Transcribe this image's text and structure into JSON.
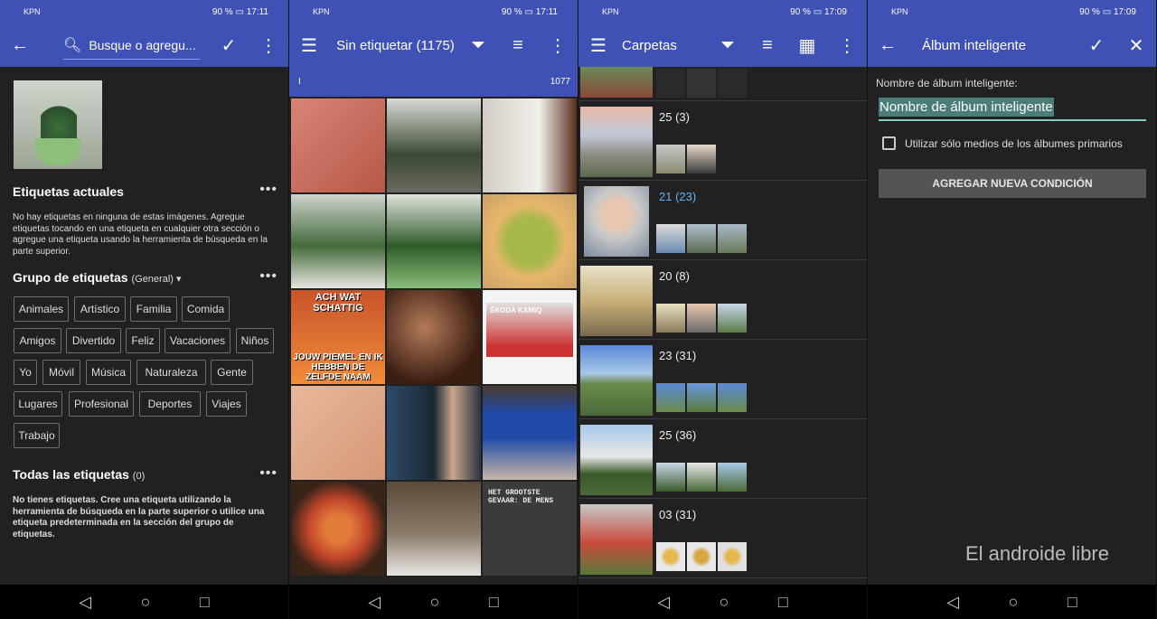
{
  "screen1": {
    "status": {
      "carrier": "KPN",
      "battery": "90 %",
      "time": "17:11"
    },
    "search_placeholder": "Busque o agregu...",
    "current_tags": {
      "title": "Etiquetas actuales",
      "text": "No hay etiquetas en ninguna de estas imágenes. Agregue etiquetas tocando en una etiqueta en cualquier otra sección o agregue una etiqueta usando la herramienta de búsqueda en la parte superior."
    },
    "tag_group": {
      "title": "Grupo de etiquetas",
      "selected": "(General)"
    },
    "chips": [
      "Animales",
      "Artístico",
      "Familia",
      "Comida",
      "Amigos",
      "Divertido",
      "Feliz",
      "Vacaciones",
      "Niños",
      "Yo",
      "Móvil",
      "Música",
      "Naturaleza",
      "Gente",
      "Lugares",
      "Profesional",
      "Deportes",
      "Viajes",
      "Trabajo"
    ],
    "all_tags": {
      "title": "Todas las etiquetas",
      "count": "(0)",
      "text": "No tienes etiquetas. Cree una etiqueta utilizando la herramienta de búsqueda en la parte superior o utilice una etiqueta predeterminada en la sección del grupo de etiquetas."
    }
  },
  "screen2": {
    "status": {
      "carrier": "KPN",
      "battery": "90 %",
      "time": "17:11"
    },
    "title": "Sin etiquetar (1175)",
    "fastscroll_left": "I",
    "fastscroll_right": "1077",
    "meme_top": "ACH WAT SCHATTIG",
    "meme_bottom": "JOUW PIEMEL EN IK HEBBEN DE ZELFDE NAAM",
    "ad_title": "ŠKODA KAMIQ",
    "book_title": "HET GROOTSTE GEVAAR: DE MENS"
  },
  "screen3": {
    "status": {
      "carrier": "KPN",
      "battery": "90 %",
      "time": "17:09"
    },
    "title": "Carpetas",
    "folders": [
      {
        "name": "25 (3)",
        "highlight": false
      },
      {
        "name": "21 (23)",
        "highlight": true
      },
      {
        "name": "20 (8)",
        "highlight": false
      },
      {
        "name": "23 (31)",
        "highlight": false
      },
      {
        "name": "25 (36)",
        "highlight": false
      },
      {
        "name": "03 (31)",
        "highlight": false
      }
    ]
  },
  "screen4": {
    "status": {
      "carrier": "KPN",
      "battery": "90 %",
      "time": "17:09"
    },
    "title": "Álbum inteligente",
    "field_label": "Nombre de álbum inteligente:",
    "field_value": "Nombre de álbum inteligente",
    "checkbox_label": "Utilizar sólo medios de los álbumes primarios",
    "button_label": "AGREGAR NUEVA CONDICIÓN",
    "watermark": "El androide libre"
  },
  "colors": {
    "primary": "#3f51b5",
    "background": "#212121",
    "accent_teal": "#80cbc4",
    "highlight_blue": "#64b5f6"
  }
}
